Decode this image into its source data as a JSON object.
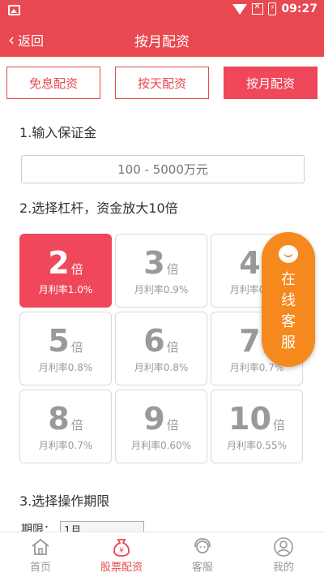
{
  "status_bar": {
    "time": "09:27"
  },
  "header": {
    "back_label": "返回",
    "title": "按月配资"
  },
  "tabs": [
    {
      "label": "免息配资",
      "active": false
    },
    {
      "label": "按天配资",
      "active": false
    },
    {
      "label": "按月配资",
      "active": true
    }
  ],
  "step1": {
    "title": "1.输入保证金",
    "input_placeholder": "100 - 5000万元"
  },
  "step2": {
    "title": "2.选择杠杆，资金放大10倍",
    "options": [
      {
        "multiple": "2",
        "unit": "倍",
        "rate": "月利率1.0%",
        "selected": true
      },
      {
        "multiple": "3",
        "unit": "倍",
        "rate": "月利率0.9%",
        "selected": false
      },
      {
        "multiple": "4",
        "unit": "倍",
        "rate": "月利率0.9%",
        "selected": false
      },
      {
        "multiple": "5",
        "unit": "倍",
        "rate": "月利率0.8%",
        "selected": false
      },
      {
        "multiple": "6",
        "unit": "倍",
        "rate": "月利率0.8%",
        "selected": false
      },
      {
        "multiple": "7",
        "unit": "倍",
        "rate": "月利率0.7%",
        "selected": false
      },
      {
        "multiple": "8",
        "unit": "倍",
        "rate": "月利率0.7%",
        "selected": false
      },
      {
        "multiple": "9",
        "unit": "倍",
        "rate": "月利率0.60%",
        "selected": false
      },
      {
        "multiple": "10",
        "unit": "倍",
        "rate": "月利率0.55%",
        "selected": false
      }
    ]
  },
  "step3": {
    "title": "3.选择操作期限",
    "period_label": "期限：",
    "period_value": "1月"
  },
  "floating_service": {
    "chars": [
      "在",
      "线",
      "客",
      "服"
    ]
  },
  "bottom_nav": [
    {
      "label": "首页",
      "icon": "home-icon",
      "active": false
    },
    {
      "label": "股票配资",
      "icon": "money-bag-icon",
      "active": true
    },
    {
      "label": "客服",
      "icon": "customer-service-icon",
      "active": false
    },
    {
      "label": "我的",
      "icon": "user-icon",
      "active": false
    }
  ],
  "colors": {
    "primary": "#e8484f",
    "selected": "#f0475b",
    "float": "#f5891e",
    "muted": "#999999"
  }
}
